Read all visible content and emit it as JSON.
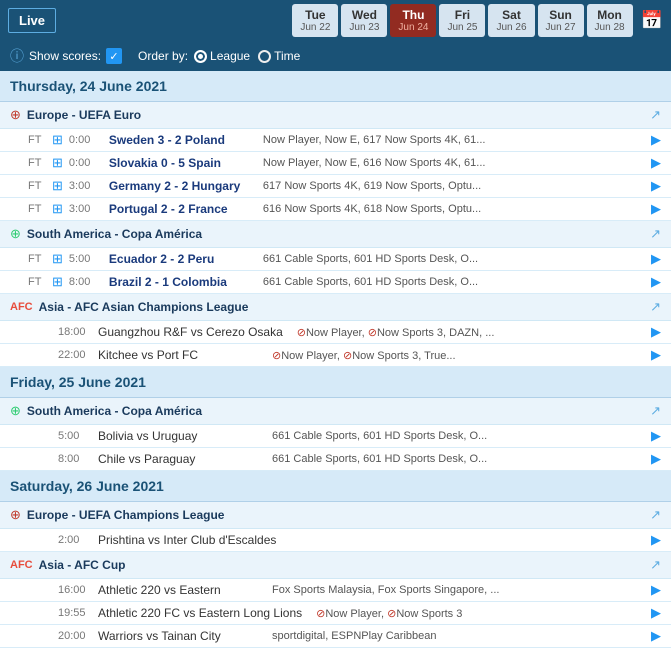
{
  "header": {
    "live_label": "Live",
    "days": [
      {
        "id": "tue",
        "name": "Tue",
        "date": "Jun 22"
      },
      {
        "id": "wed",
        "name": "Wed",
        "date": "Jun 23"
      },
      {
        "id": "thu",
        "name": "Thu",
        "date": "Jun 24",
        "active": true
      },
      {
        "id": "fri",
        "name": "Fri",
        "date": "Jun 25"
      },
      {
        "id": "sat",
        "name": "Sat",
        "date": "Jun 26"
      },
      {
        "id": "sun",
        "name": "Sun",
        "date": "Jun 27"
      },
      {
        "id": "mon",
        "name": "Mon",
        "date": "Jun 28"
      }
    ]
  },
  "filter": {
    "show_scores_label": "Show scores:",
    "order_by_label": "Order by:",
    "league_label": "League",
    "time_label": "Time",
    "league_selected": true,
    "time_selected": false
  },
  "schedule": [
    {
      "date_heading": "Thursday, 24 June 2021",
      "competitions": [
        {
          "id": "euro",
          "flag": "🔴",
          "name": "Europe - UEFA Euro",
          "matches": [
            {
              "status": "FT",
              "time": "0:00",
              "teams": "Sweden 3 - 2 Poland",
              "bold": true,
              "channels": "Now Player, Now E, 617 Now Sports 4K, 61..."
            },
            {
              "status": "FT",
              "time": "0:00",
              "teams": "Slovakia 0 - 5 Spain",
              "bold": true,
              "channels": "Now Player, Now E, 616 Now Sports 4K, 61..."
            },
            {
              "status": "FT",
              "time": "3:00",
              "teams": "Germany 2 - 2 Hungary",
              "bold": true,
              "channels": "617 Now Sports 4K, 619 Now Sports, Optu..."
            },
            {
              "status": "FT",
              "time": "3:00",
              "teams": "Portugal 2 - 2 France",
              "bold": true,
              "channels": "616 Now Sports 4K, 618 Now Sports, Optu..."
            }
          ]
        },
        {
          "id": "copa",
          "flag": "🌎",
          "name": "South America - Copa América",
          "matches": [
            {
              "status": "FT",
              "time": "5:00",
              "teams": "Ecuador 2 - 2 Peru",
              "bold": true,
              "channels": "661 Cable Sports, 601 HD Sports Desk, O..."
            },
            {
              "status": "FT",
              "time": "8:00",
              "teams": "Brazil 2 - 1 Colombia",
              "bold": true,
              "channels": "661 Cable Sports, 601 HD Sports Desk, O..."
            }
          ]
        },
        {
          "id": "afc-cl",
          "flag": "🏆",
          "name": "Asia - AFC Asian Champions League",
          "matches": [
            {
              "status": "",
              "time": "18:00",
              "teams": "Guangzhou R&F vs Cerezo Osaka",
              "bold": false,
              "channels_no": "Now Player, Now Sports 3, DAZN, ..."
            },
            {
              "status": "",
              "time": "22:00",
              "teams": "Kitchee vs Port FC",
              "bold": false,
              "channels_no": "Now Player, Now Sports 3, True..."
            }
          ]
        }
      ]
    },
    {
      "date_heading": "Friday, 25 June 2021",
      "competitions": [
        {
          "id": "copa2",
          "flag": "🌎",
          "name": "South America - Copa América",
          "matches": [
            {
              "status": "",
              "time": "5:00",
              "teams": "Bolivia vs Uruguay",
              "bold": false,
              "channels": "661 Cable Sports, 601 HD Sports Desk, O..."
            },
            {
              "status": "",
              "time": "8:00",
              "teams": "Chile vs Paraguay",
              "bold": false,
              "channels": "661 Cable Sports, 601 HD Sports Desk, O..."
            }
          ]
        }
      ]
    },
    {
      "date_heading": "Saturday, 26 June 2021",
      "competitions": [
        {
          "id": "ucl",
          "flag": "🔴",
          "name": "Europe - UEFA Champions League",
          "matches": [
            {
              "status": "",
              "time": "2:00",
              "teams": "Prishtina vs Inter Club d'Escaldes",
              "bold": false,
              "channels": ""
            }
          ]
        },
        {
          "id": "afc-cup",
          "flag": "🏆",
          "name": "Asia - AFC Cup",
          "matches": [
            {
              "status": "",
              "time": "16:00",
              "teams": "Athletic 220 vs Eastern",
              "bold": false,
              "channels": "Fox Sports Malaysia, Fox Sports Singapore, ..."
            },
            {
              "status": "",
              "time": "19:55",
              "teams": "Athletic 220 FC vs Eastern Long Lions",
              "bold": false,
              "channels_no": "Now Player, Now Sports 3"
            },
            {
              "status": "",
              "time": "20:00",
              "teams": "Warriors vs Tainan City",
              "bold": false,
              "channels": "sportdigital, ESPNPlay Caribbean"
            }
          ]
        }
      ]
    }
  ]
}
